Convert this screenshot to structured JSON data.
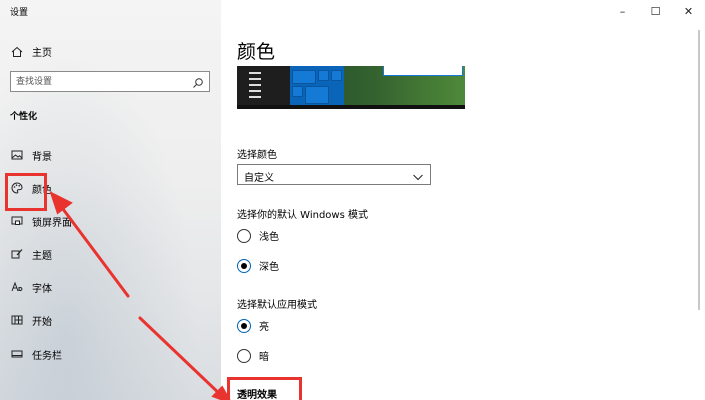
{
  "window": {
    "title": "设置",
    "controls": {
      "minimize": "–",
      "maximize": "☐",
      "close": "✕"
    }
  },
  "nav": {
    "home_label": "主页",
    "search_placeholder": "查找设置",
    "section_label": "个性化",
    "items": [
      {
        "label": "背景",
        "icon": "image-icon"
      },
      {
        "label": "颜色",
        "icon": "palette-icon",
        "selected": true
      },
      {
        "label": "锁屏界面",
        "icon": "lock-screen-icon"
      },
      {
        "label": "主题",
        "icon": "theme-brush-icon"
      },
      {
        "label": "字体",
        "icon": "font-icon"
      },
      {
        "label": "开始",
        "icon": "start-grid-icon"
      },
      {
        "label": "任务栏",
        "icon": "taskbar-icon"
      }
    ]
  },
  "main": {
    "title": "颜色",
    "choose_color_label": "选择颜色",
    "choose_color_value": "自定义",
    "windows_mode_label": "选择你的默认 Windows 模式",
    "windows_mode_options": [
      {
        "label": "浅色",
        "checked": false
      },
      {
        "label": "深色",
        "checked": true
      }
    ],
    "app_mode_label": "选择默认应用模式",
    "app_mode_options": [
      {
        "label": "亮",
        "checked": true
      },
      {
        "label": "暗",
        "checked": false
      }
    ],
    "transparency_label": "透明效果"
  },
  "colors": {
    "annotation_red": "#e8332f",
    "accent_blue": "#0063b1"
  }
}
